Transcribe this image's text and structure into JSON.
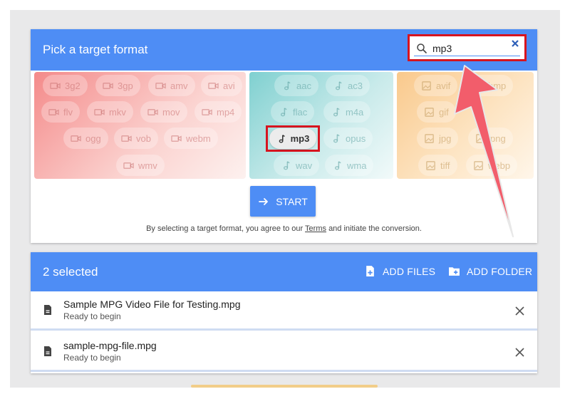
{
  "header": {
    "title": "Pick a target format",
    "search_value": "mp3"
  },
  "formats": {
    "video": [
      "3g2",
      "3gp",
      "amv",
      "avi",
      "flv",
      "mkv",
      "mov",
      "mp4",
      "ogg",
      "vob",
      "webm",
      "wmv"
    ],
    "audio": [
      "aac",
      "ac3",
      "flac",
      "m4a",
      "mp3",
      "opus",
      "wav",
      "wma"
    ],
    "image": [
      "avif",
      "bmp",
      "gif",
      "jpg",
      "png",
      "tiff",
      "webp"
    ]
  },
  "selected_format": "mp3",
  "start_label": "START",
  "terms": {
    "before": "By selecting a target format, you agree to our",
    "link": "Terms",
    "after": "and initiate the conversion."
  },
  "files_card": {
    "selected_label": "2 selected",
    "add_files_label": "ADD FILES",
    "add_folder_label": "ADD FOLDER",
    "files": [
      {
        "name": "Sample MPG Video File for Testing.mpg",
        "status": "Ready to begin"
      },
      {
        "name": "sample-mpg-file.mpg",
        "status": "Ready to begin"
      }
    ]
  },
  "colors": {
    "primary": "#4e8df5",
    "highlight": "#d7141f",
    "arrow": "#f25d6b"
  }
}
